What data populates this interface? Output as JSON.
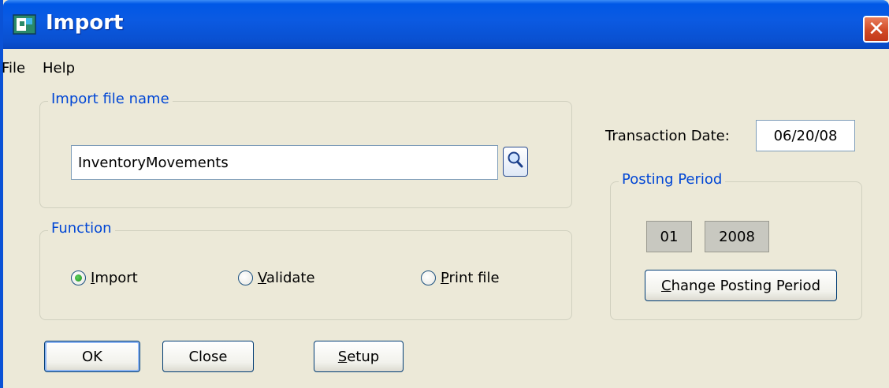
{
  "window": {
    "title": "Import"
  },
  "menu": {
    "file": "File",
    "help": "Help"
  },
  "import_file": {
    "group_label": "Import file name",
    "value": "InventoryMovements"
  },
  "function": {
    "group_label": "Function",
    "options": [
      {
        "label": "Import",
        "mnemonic": "I",
        "rest": "mport",
        "selected": true
      },
      {
        "label": "Validate",
        "mnemonic": "V",
        "rest": "alidate",
        "selected": false
      },
      {
        "label": "Print file",
        "mnemonic": "P",
        "rest": "rint file",
        "selected": false
      }
    ]
  },
  "transaction": {
    "label": "Transaction Date:",
    "value": "06/20/08"
  },
  "posting_period": {
    "group_label": "Posting Period",
    "period": "01",
    "year": "2008",
    "change_button": {
      "mnemonic": "C",
      "rest": "hange Posting Period"
    }
  },
  "buttons": {
    "ok": "OK",
    "close": "Close",
    "setup": {
      "mnemonic": "S",
      "rest": "etup"
    }
  },
  "colors": {
    "title_bar": "#0a52d6",
    "group_label": "#0046d5",
    "dialog_bg": "#ece9d8",
    "close_button": "#d14a26"
  }
}
